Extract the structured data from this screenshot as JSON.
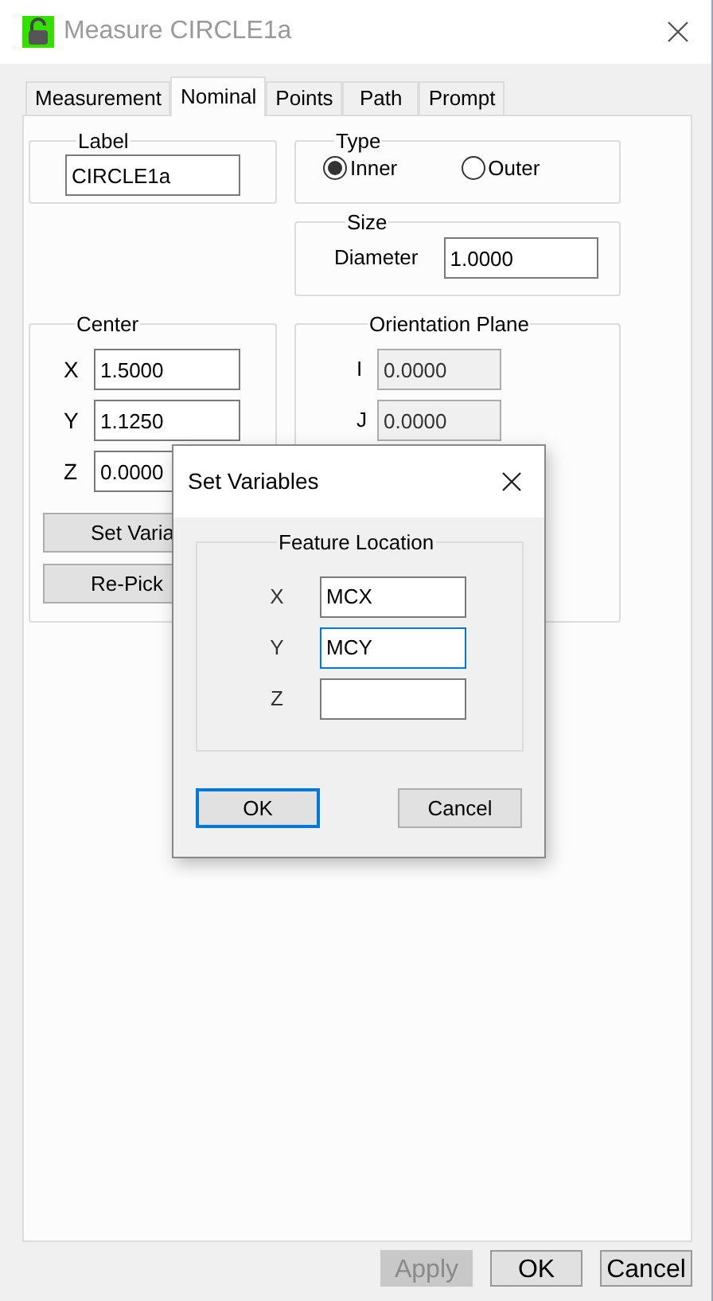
{
  "window": {
    "title": "Measure CIRCLE1a"
  },
  "tabs": [
    {
      "label": "Measurement",
      "selected": false
    },
    {
      "label": "Nominal",
      "selected": true
    },
    {
      "label": "Points",
      "selected": false
    },
    {
      "label": "Path",
      "selected": false
    },
    {
      "label": "Prompt",
      "selected": false
    }
  ],
  "label_group": {
    "title": "Label",
    "value": "CIRCLE1a"
  },
  "type_group": {
    "title": "Type",
    "options": [
      {
        "label": "Inner",
        "selected": true
      },
      {
        "label": "Outer",
        "selected": false
      }
    ]
  },
  "size_group": {
    "title": "Size",
    "fields": [
      {
        "label": "Diameter",
        "value": "1.0000"
      }
    ]
  },
  "center_group": {
    "title": "Center",
    "fields": [
      {
        "label": "X",
        "value": "1.5000",
        "disabled": false
      },
      {
        "label": "Y",
        "value": "1.1250",
        "disabled": false
      },
      {
        "label": "Z",
        "value": "0.0000",
        "disabled": false
      }
    ],
    "buttons": [
      "Set Varia",
      "Re-Pick"
    ]
  },
  "orientation_group": {
    "title": "Orientation Plane",
    "fields": [
      {
        "label": "I",
        "value": "0.0000",
        "disabled": true
      },
      {
        "label": "J",
        "value": "0.0000",
        "disabled": true
      }
    ]
  },
  "footer_buttons": [
    {
      "label": "Apply",
      "disabled": true
    },
    {
      "label": "OK",
      "disabled": false
    },
    {
      "label": "Cancel",
      "disabled": false
    }
  ],
  "dialog": {
    "title": "Set Variables",
    "group_title": "Feature Location",
    "fields": [
      {
        "label": "X",
        "value": "MCX",
        "focused": false
      },
      {
        "label": "Y",
        "value": "MCY",
        "focused": true
      },
      {
        "label": "Z",
        "focused": false
      }
    ],
    "buttons": [
      {
        "label": "OK",
        "default": true
      },
      {
        "label": "Cancel",
        "default": false
      }
    ]
  }
}
